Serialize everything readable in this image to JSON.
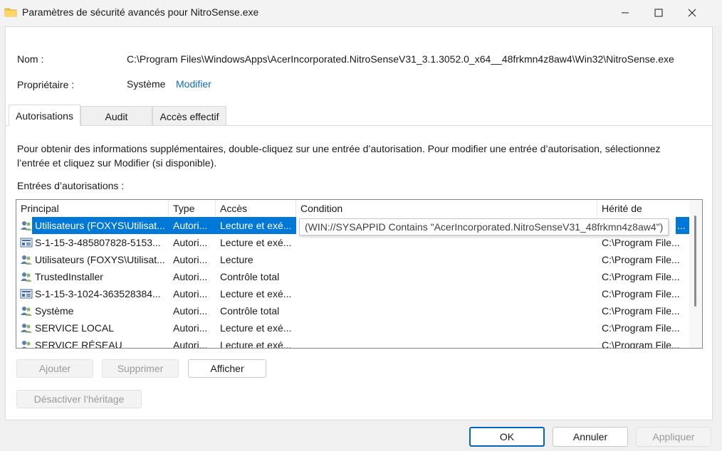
{
  "window": {
    "title": "Paramètres de sécurité avancés pour NitroSense.exe",
    "icon": "folder-icon",
    "controls": [
      "minimize-icon",
      "maximize-icon",
      "close-icon"
    ]
  },
  "info": {
    "name_label": "Nom :",
    "name_value": "C:\\Program Files\\WindowsApps\\AcerIncorporated.NitroSenseV31_3.1.3052.0_x64__48frkmn4z8aw4\\Win32\\NitroSense.exe",
    "owner_label": "Propriétaire :",
    "owner_value": "Système",
    "owner_change_link": "Modifier"
  },
  "tabs": [
    {
      "label": "Autorisations",
      "active": true
    },
    {
      "label": "Audit",
      "active": false
    },
    {
      "label": "Accès effectif",
      "active": false
    }
  ],
  "description": "Pour obtenir des informations supplémentaires, double-cliquez sur une entrée d’autorisation. Pour modifier une entrée d’autorisation, sélectionnez l’entrée et cliquez sur Modifier (si disponible).",
  "entries_label": "Entrées d’autorisations :",
  "table": {
    "headers": [
      "Principal",
      "Type",
      "Accès",
      "Condition",
      "Hérité de"
    ],
    "rows": [
      {
        "icon": "users-icon",
        "principal": "Utilisateurs (FOXYS\\Utilisat...",
        "type": "Autori...",
        "access": "Lecture et exé...",
        "condition": "(WIN://SYSAPPID Contains \"AcerIncorporated.NitroSenseV31_48frkmn4z8aw4\")",
        "inherited": "...",
        "selected": true
      },
      {
        "icon": "sid-icon",
        "principal": "S-1-15-3-485807828-5153...",
        "type": "Autori...",
        "access": "Lecture et exé...",
        "condition": "",
        "inherited": "C:\\Program File..."
      },
      {
        "icon": "users-icon",
        "principal": "Utilisateurs (FOXYS\\Utilisat...",
        "type": "Autori...",
        "access": "Lecture",
        "condition": "",
        "inherited": "C:\\Program File..."
      },
      {
        "icon": "users-icon",
        "principal": "TrustedInstaller",
        "type": "Autori...",
        "access": "Contrôle total",
        "condition": "",
        "inherited": "C:\\Program File..."
      },
      {
        "icon": "sid-icon",
        "principal": "S-1-15-3-1024-363528384...",
        "type": "Autori...",
        "access": "Lecture et exé...",
        "condition": "",
        "inherited": "C:\\Program File..."
      },
      {
        "icon": "users-icon",
        "principal": "Système",
        "type": "Autori...",
        "access": "Contrôle total",
        "condition": "",
        "inherited": "C:\\Program File..."
      },
      {
        "icon": "users-icon",
        "principal": "SERVICE LOCAL",
        "type": "Autori...",
        "access": "Lecture et exé...",
        "condition": "",
        "inherited": "C:\\Program File..."
      },
      {
        "icon": "users-icon",
        "principal": "SERVICE RÉSEAU",
        "type": "Autori...",
        "access": "Lecture et exé...",
        "condition": "",
        "inherited": "C:\\Program File..."
      }
    ]
  },
  "buttons": {
    "add": "Ajouter",
    "remove": "Supprimer",
    "view": "Afficher",
    "disable_inheritance": "Désactiver l’héritage",
    "ok": "OK",
    "cancel": "Annuler",
    "apply": "Appliquer"
  },
  "colors": {
    "selection": "#0078d7",
    "link": "#0f6cbd",
    "default_button_border": "#0067c0"
  }
}
